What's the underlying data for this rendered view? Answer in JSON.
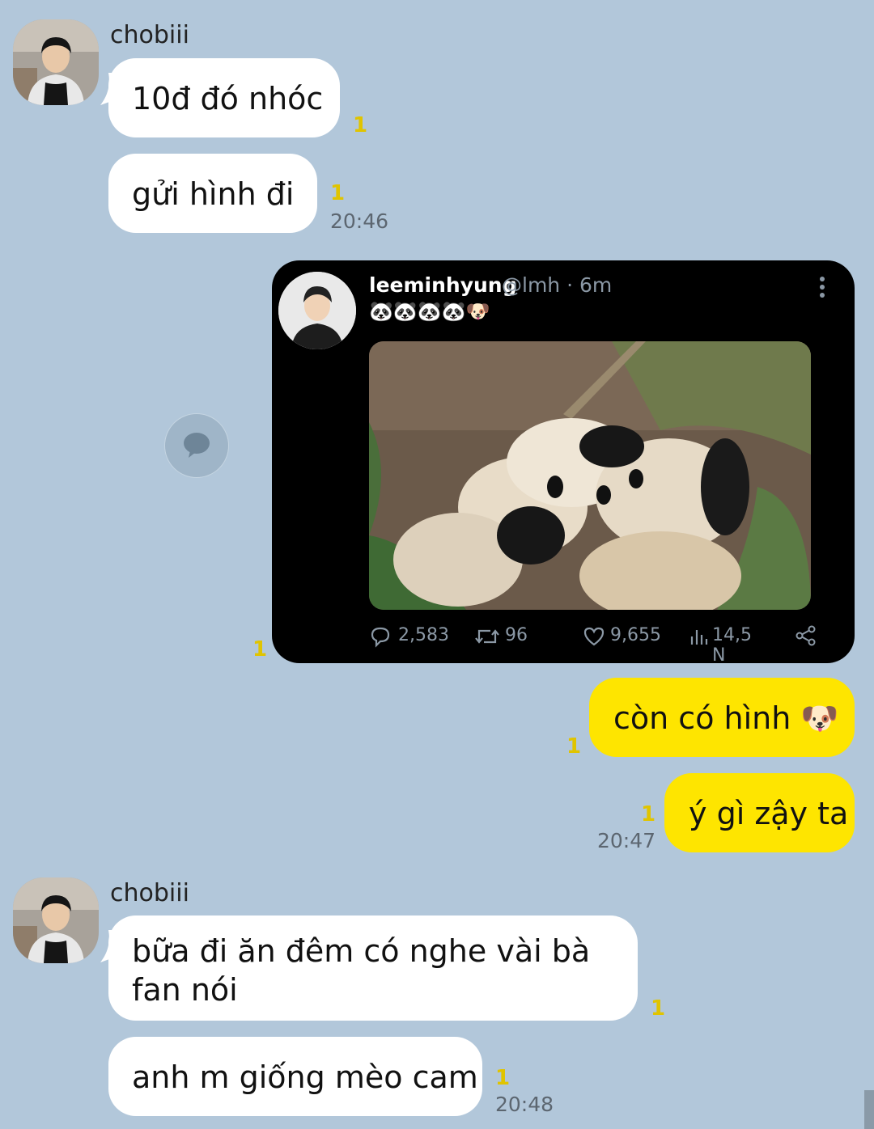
{
  "messages": {
    "group1": {
      "sender": "chobiii",
      "bubble1": {
        "text": "10đ đó nhóc",
        "unread": "1"
      },
      "bubble2": {
        "text": "gửi hình đi",
        "unread": "1",
        "time": "20:46"
      }
    },
    "tweet_card": {
      "unread": "1",
      "name": "leeminhyung",
      "handle": "@lmh · 6m",
      "emojis": "🐼🐼🐼🐼🐶",
      "stats": {
        "replies": "2,583",
        "retweets": "96",
        "likes": "9,655",
        "views": "14,5 N"
      }
    },
    "my1": {
      "text": "còn có hình 🐶",
      "unread": "1"
    },
    "my2": {
      "text": "ý gì zậy ta",
      "unread": "1",
      "time": "20:47"
    },
    "group2": {
      "sender": "chobiii",
      "bubble1": {
        "text": "bữa đi ăn đêm có nghe vài bà fan nói",
        "unread": "1"
      },
      "bubble2": {
        "text": "anh m giống mèo cam",
        "unread": "1",
        "time": "20:48"
      }
    }
  },
  "icons": {
    "share": "speech-bubble-icon",
    "more": "more-vertical-icon",
    "reply": "comment-icon",
    "retweet": "retweet-icon",
    "like": "heart-icon",
    "views": "bar-chart-icon",
    "share_tweet": "share-icon"
  },
  "colors": {
    "background": "#b2c7da",
    "my_bubble": "#fee500",
    "their_bubble": "#ffffff",
    "unread": "#e0c400"
  }
}
